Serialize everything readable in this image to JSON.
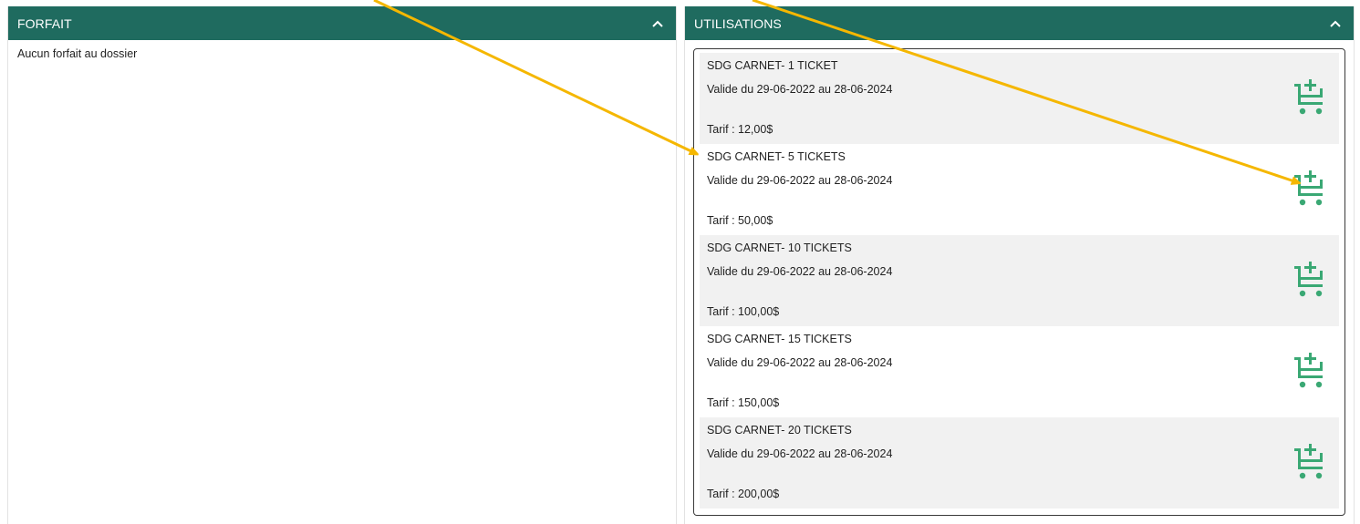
{
  "colors": {
    "header_bg": "#1f6b5f",
    "cart_icon": "#3aa874",
    "arrow": "#f5b700",
    "row_alt_bg": "#f1f1f1"
  },
  "left_panel": {
    "title": "FORFAIT",
    "collapse_icon": "chevron-up-icon",
    "empty_message": "Aucun forfait au dossier"
  },
  "right_panel": {
    "title": "UTILISATIONS",
    "collapse_icon": "chevron-up-icon",
    "items": [
      {
        "name": "SDG CARNET- 1 TICKET",
        "validity": "Valide du 29-06-2022 au 28-06-2024",
        "price": "Tarif : 12,00$",
        "action_icon": "add-to-cart-icon"
      },
      {
        "name": "SDG CARNET- 5 TICKETS",
        "validity": "Valide du 29-06-2022 au 28-06-2024",
        "price": "Tarif : 50,00$",
        "action_icon": "add-to-cart-icon"
      },
      {
        "name": "SDG CARNET- 10 TICKETS",
        "validity": "Valide du 29-06-2022 au 28-06-2024",
        "price": "Tarif : 100,00$",
        "action_icon": "add-to-cart-icon"
      },
      {
        "name": "SDG CARNET- 15 TICKETS",
        "validity": "Valide du 29-06-2022 au 28-06-2024",
        "price": "Tarif : 150,00$",
        "action_icon": "add-to-cart-icon"
      },
      {
        "name": "SDG CARNET- 20 TICKETS",
        "validity": "Valide du 29-06-2022 au 28-06-2024",
        "price": "Tarif : 200,00$",
        "action_icon": "add-to-cart-icon"
      }
    ]
  }
}
